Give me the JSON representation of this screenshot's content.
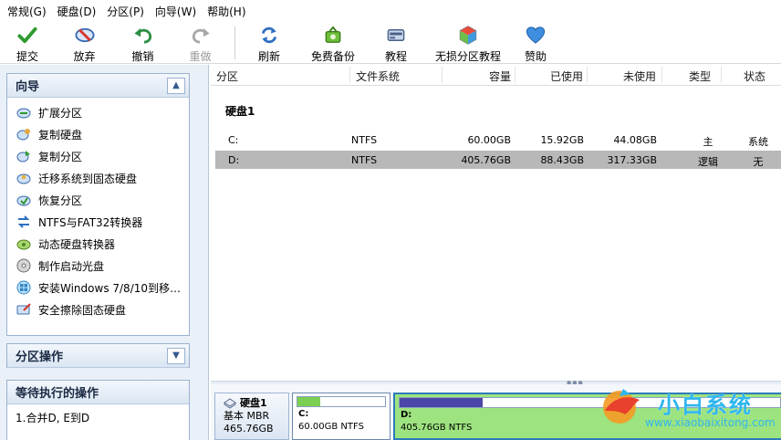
{
  "menu": [
    "常规(G)",
    "硬盘(D)",
    "分区(P)",
    "向导(W)",
    "帮助(H)"
  ],
  "toolbar": [
    {
      "label": "提交",
      "icon": "check-icon"
    },
    {
      "label": "放弃",
      "icon": "discard-icon"
    },
    {
      "label": "撤销",
      "icon": "undo-icon"
    },
    {
      "label": "重做",
      "icon": "redo-icon",
      "disabled": true
    },
    {
      "label": "刷新",
      "icon": "refresh-icon"
    },
    {
      "label": "免费备份",
      "icon": "backup-icon"
    },
    {
      "label": "教程",
      "icon": "tutorial-icon"
    },
    {
      "label": "无损分区教程",
      "icon": "partition-tutorial-icon"
    },
    {
      "label": "赞助",
      "icon": "heart-icon"
    }
  ],
  "left_panel": {
    "wizard_title": "向导",
    "wizard_items": [
      "扩展分区",
      "复制硬盘",
      "复制分区",
      "迁移系统到固态硬盘",
      "恢复分区",
      "NTFS与FAT32转换器",
      "动态硬盘转换器",
      "制作启动光盘",
      "安装Windows 7/8/10到移…",
      "安全擦除固态硬盘"
    ],
    "partition_ops_title": "分区操作",
    "pending_title": "等待执行的操作",
    "pending_items": [
      "1.合并D, E到D"
    ]
  },
  "table": {
    "columns": [
      "分区",
      "文件系统",
      "容量",
      "已使用",
      "未使用",
      "类型",
      "状态"
    ],
    "disk_label": "硬盘1",
    "rows": [
      {
        "name": "C:",
        "fs": "NTFS",
        "capacity": "60.00GB",
        "used": "15.92GB",
        "free": "44.08GB",
        "type": "主",
        "status": "系统",
        "selected": false
      },
      {
        "name": "D:",
        "fs": "NTFS",
        "capacity": "405.76GB",
        "used": "88.43GB",
        "free": "317.33GB",
        "type": "逻辑",
        "status": "无",
        "selected": true
      }
    ]
  },
  "disk_map": {
    "disk": {
      "name": "硬盘1",
      "style": "基本 MBR",
      "size": "465.76GB"
    },
    "partitions": [
      {
        "label": "C:",
        "desc": "60.00GB NTFS",
        "used_fraction": 0.265
      },
      {
        "label": "D:",
        "desc": "405.76GB NTFS",
        "used_fraction": 0.218
      }
    ]
  },
  "watermark": {
    "title": "小白系统",
    "url": "www.xiaobaixitong.com"
  },
  "colors": {
    "selected_row": "#b8b8b8",
    "bar_fill": "#4a47a8",
    "selected_partition": "#9de37f",
    "watermark": "#2fb6ef"
  }
}
